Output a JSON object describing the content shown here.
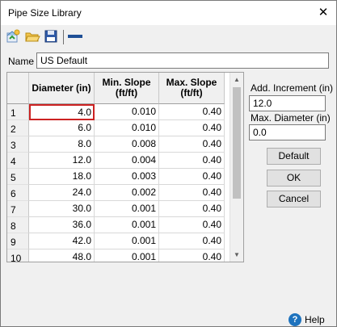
{
  "window": {
    "title": "Pipe Size Library",
    "close_glyph": "✕"
  },
  "toolbar": {
    "icons": [
      "new-library-icon",
      "open-folder-icon",
      "save-disk-icon",
      "remove-line-icon"
    ]
  },
  "name": {
    "label": "Name",
    "value": "US Default"
  },
  "grid": {
    "headers": [
      "Diameter (in)",
      "Min. Slope\n(ft/ft)",
      "Max. Slope\n(ft/ft)"
    ],
    "rows": [
      {
        "num": "1",
        "diameter": "4.0",
        "min_slope": "0.010",
        "max_slope": "0.40"
      },
      {
        "num": "2",
        "diameter": "6.0",
        "min_slope": "0.010",
        "max_slope": "0.40"
      },
      {
        "num": "3",
        "diameter": "8.0",
        "min_slope": "0.008",
        "max_slope": "0.40"
      },
      {
        "num": "4",
        "diameter": "12.0",
        "min_slope": "0.004",
        "max_slope": "0.40"
      },
      {
        "num": "5",
        "diameter": "18.0",
        "min_slope": "0.003",
        "max_slope": "0.40"
      },
      {
        "num": "6",
        "diameter": "24.0",
        "min_slope": "0.002",
        "max_slope": "0.40"
      },
      {
        "num": "7",
        "diameter": "30.0",
        "min_slope": "0.001",
        "max_slope": "0.40"
      },
      {
        "num": "8",
        "diameter": "36.0",
        "min_slope": "0.001",
        "max_slope": "0.40"
      },
      {
        "num": "9",
        "diameter": "42.0",
        "min_slope": "0.001",
        "max_slope": "0.40"
      },
      {
        "num": "10",
        "diameter": "48.0",
        "min_slope": "0.001",
        "max_slope": "0.40"
      }
    ],
    "selected_row": 0
  },
  "side": {
    "add_increment_label": "Add. Increment (in)",
    "add_increment_value": "12.0",
    "max_diameter_label": "Max. Diameter (in)",
    "max_diameter_value": "0.0"
  },
  "buttons": {
    "default": "Default",
    "ok": "OK",
    "cancel": "Cancel"
  },
  "help": {
    "label": "Help",
    "glyph": "?"
  },
  "colors": {
    "selection_border": "#cc2222",
    "help_blue": "#1e73be"
  }
}
